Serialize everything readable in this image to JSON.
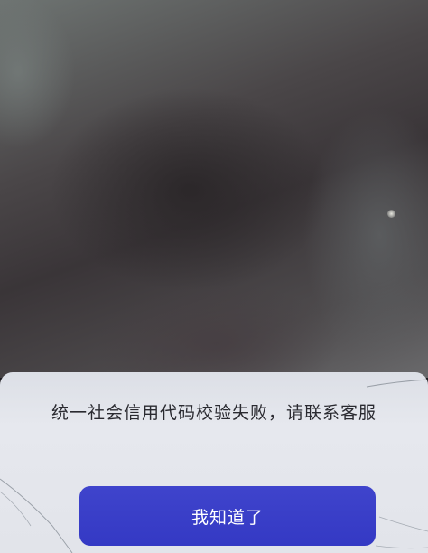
{
  "camera_view": {
    "description_icon": "camera-preview"
  },
  "dialog": {
    "message": "统一社会信用代码校验失败，请联系客服",
    "confirm_label": "我知道了"
  },
  "colors": {
    "accent": "#3a3fc8",
    "dialog_bg": "#e4e6ec",
    "message_text": "#2a2a30"
  }
}
